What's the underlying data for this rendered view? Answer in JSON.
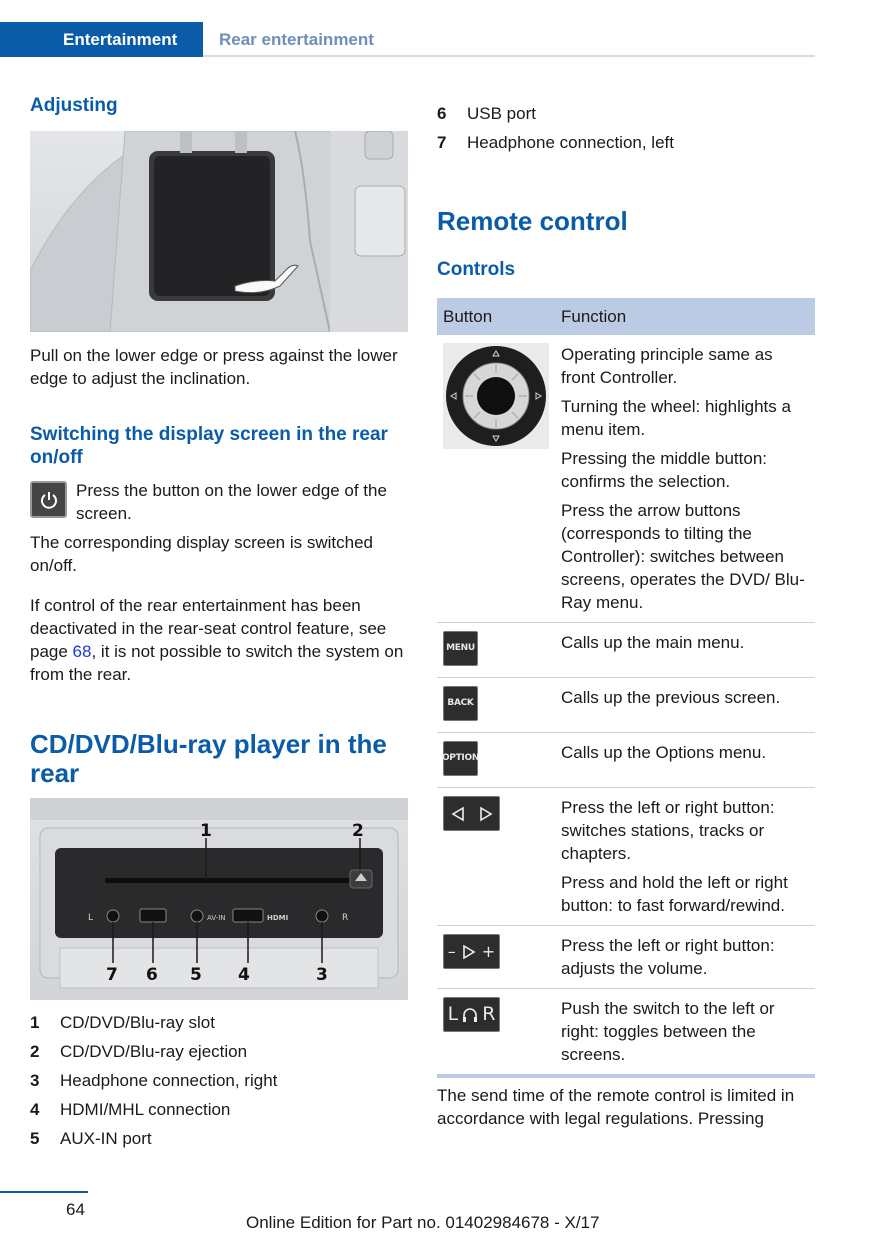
{
  "header": {
    "section": "Entertainment",
    "subsection": "Rear entertainment"
  },
  "left": {
    "adjusting_heading": "Adjusting",
    "adjusting_text": "Pull on the lower edge or press against the lower edge to adjust the inclination.",
    "switch_heading": "Switching the display screen in the rear on/off",
    "switch_press": "Press the button on the lower edge of the screen.",
    "switch_corresponding": "The corresponding display screen is switched on/off.",
    "ifctl_before": "If control of the rear entertainment has been deactivated in the rear-seat control feature, see page ",
    "ifctl_link": "68",
    "ifctl_after": ", it is not possible to switch the system on from the rear.",
    "cd_heading": "CD/DVD/Blu-ray player in the rear",
    "figure_labels": {
      "n1": "1",
      "n2": "2",
      "n3": "3",
      "n4": "4",
      "n5": "5",
      "n6": "6",
      "n7": "7",
      "lr_left": "L",
      "lr_right": "R",
      "avin": "AV-IN",
      "hdmi": "HDMI"
    },
    "list": [
      {
        "num": "1",
        "text": "CD/DVD/Blu-ray slot"
      },
      {
        "num": "2",
        "text": "CD/DVD/Blu-ray ejection"
      },
      {
        "num": "3",
        "text": "Headphone connection, right"
      },
      {
        "num": "4",
        "text": "HDMI/MHL connection"
      },
      {
        "num": "5",
        "text": "AUX-IN port"
      }
    ]
  },
  "right": {
    "list": [
      {
        "num": "6",
        "text": "USB port"
      },
      {
        "num": "7",
        "text": "Headphone connection, left"
      }
    ],
    "remote_heading": "Remote control",
    "controls_heading": "Controls",
    "table": {
      "col_button": "Button",
      "col_function": "Function",
      "row_controller": [
        "Operating principle same as front Controller.",
        "Turning the wheel: highlights a menu item.",
        "Pressing the middle button: confirms the selection.",
        "Press the arrow buttons (corresponds to tilting the Controller): switches between screens, operates the DVD/ Blu-Ray menu."
      ],
      "menu_key": "MENU",
      "row_menu": "Calls up the main menu.",
      "back_key": "BACK",
      "row_back": "Calls up the previous screen.",
      "option_key": "OPTION",
      "row_option": "Calls up the Options menu.",
      "row_arrows": [
        "Press the left or right button: switches stations, tracks or chapters.",
        "Press and hold the left or right button: to fast forward/rewind."
      ],
      "vol_minus": "–",
      "vol_plus": "+",
      "row_volume": "Press the left or right button: adjusts the volume.",
      "lr_key_left": "L",
      "lr_key_right": "R",
      "row_lr": "Push the switch to the left or right: toggles between the screens."
    },
    "send_text": "The send time of the remote control is limited in accordance with legal regulations. Pressing"
  },
  "footer": {
    "page_number": "64",
    "edition": "Online Edition for Part no. 01402984678 - X/17"
  }
}
